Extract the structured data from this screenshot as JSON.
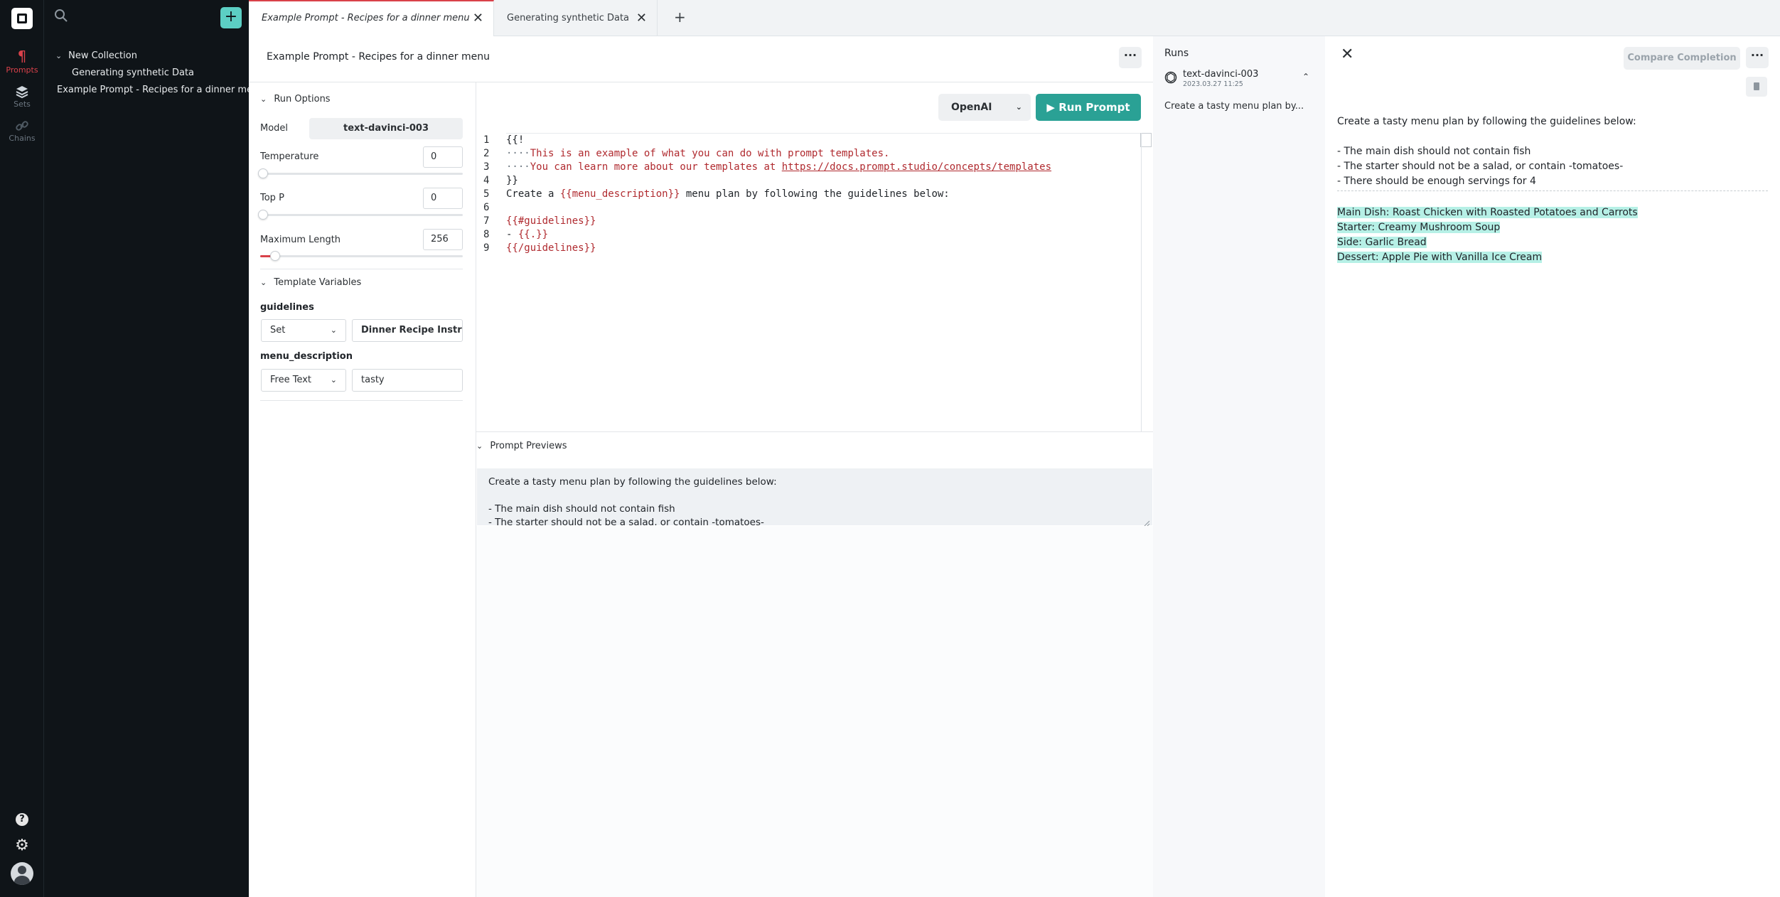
{
  "rail": {
    "items": [
      {
        "label": "Prompts",
        "icon": "paragraph-icon"
      },
      {
        "label": "Sets",
        "icon": "layers-icon"
      },
      {
        "label": "Chains",
        "icon": "link-icon"
      }
    ],
    "help_glyph": "?",
    "settings_glyph": "⚙"
  },
  "tree": {
    "add_glyph": "+",
    "collection": "New Collection",
    "child": "Generating synthetic Data",
    "root_item": "Example Prompt - Recipes for a dinner menu"
  },
  "tabs": [
    {
      "label": "Example Prompt - Recipes for a dinner menu",
      "active": true
    },
    {
      "label": "Generating synthetic Data",
      "active": false
    }
  ],
  "tab_close_glyph": "✕",
  "tab_add_glyph": "+",
  "prompt": {
    "title": "Example Prompt - Recipes for a dinner menu",
    "menu_glyph": "···"
  },
  "run_options": {
    "heading": "Run Options",
    "model_label": "Model",
    "model_value": "text-davinci-003",
    "temperature_label": "Temperature",
    "temperature_value": "0",
    "temperature_level": 0,
    "top_p_label": "Top P",
    "top_p_value": "0",
    "top_p_level": 0,
    "max_length_label": "Maximum Length",
    "max_length_value": "256",
    "max_length_level": 0.06
  },
  "template_variables": {
    "heading": "Template Variables",
    "vars": [
      {
        "name": "guidelines",
        "type": "Set",
        "value": "Dinner Recipe Instr"
      },
      {
        "name": "menu_description",
        "type": "Free Text",
        "value": "tasty"
      }
    ]
  },
  "toolbar": {
    "provider": "OpenAI",
    "run_label": "Run Prompt"
  },
  "editor": {
    "lines": [
      {
        "n": "1",
        "parts": [
          {
            "t": "{{!",
            "c": "default"
          }
        ]
      },
      {
        "n": "2",
        "parts": [
          {
            "t": "····",
            "c": "guide"
          },
          {
            "t": "This is an example of what you can do with prompt templates.",
            "c": "comment"
          }
        ]
      },
      {
        "n": "3",
        "parts": [
          {
            "t": "····",
            "c": "guide"
          },
          {
            "t": "You can learn more about our templates at ",
            "c": "comment"
          },
          {
            "t": "https://docs.prompt.studio/concepts/templates",
            "c": "link"
          }
        ]
      },
      {
        "n": "4",
        "parts": [
          {
            "t": "}}",
            "c": "default"
          }
        ]
      },
      {
        "n": "5",
        "parts": [
          {
            "t": "Create a ",
            "c": "default"
          },
          {
            "t": "{{menu_description}}",
            "c": "var"
          },
          {
            "t": " menu plan by following the guidelines below:",
            "c": "default"
          }
        ]
      },
      {
        "n": "6",
        "parts": []
      },
      {
        "n": "7",
        "parts": [
          {
            "t": "{{#guidelines}}",
            "c": "var"
          }
        ]
      },
      {
        "n": "8",
        "parts": [
          {
            "t": "- ",
            "c": "default"
          },
          {
            "t": "{{.}}",
            "c": "var"
          }
        ]
      },
      {
        "n": "9",
        "parts": [
          {
            "t": "{{/guidelines}}",
            "c": "var"
          }
        ]
      }
    ]
  },
  "previews": {
    "heading": "Prompt Previews",
    "lines": [
      "Create a tasty menu plan by following the guidelines below:",
      "",
      "- The main dish should not contain fish",
      "- The starter should not be a salad, or contain -tomatoes-"
    ]
  },
  "runs": {
    "title": "Runs",
    "items": [
      {
        "model": "text-davinci-003",
        "date": "2023.03.27 11:25",
        "snippet": "Create a tasty menu plan by..."
      }
    ]
  },
  "completion": {
    "close_glyph": "✕",
    "compare_label": "Compare Completion",
    "prompt_lines": [
      "Create a tasty menu plan by following the guidelines below:",
      "",
      "- The main dish should not contain fish",
      "- The starter should not be a salad, or contain -tomatoes-",
      "- There should be enough servings for 4"
    ],
    "result_lines": [
      "Main Dish: Roast Chicken with Roasted Potatoes and Carrots",
      "Starter: Creamy Mushroom Soup",
      "Side: Garlic Bread",
      "Dessert: Apple Pie with Vanilla Ice Cream"
    ]
  },
  "colors": {
    "accent": "#d9414a",
    "run_button": "#2aa195",
    "add_button": "#5ccfc4",
    "highlight": "#b6f0e6",
    "sidebar": "#0f1418"
  }
}
